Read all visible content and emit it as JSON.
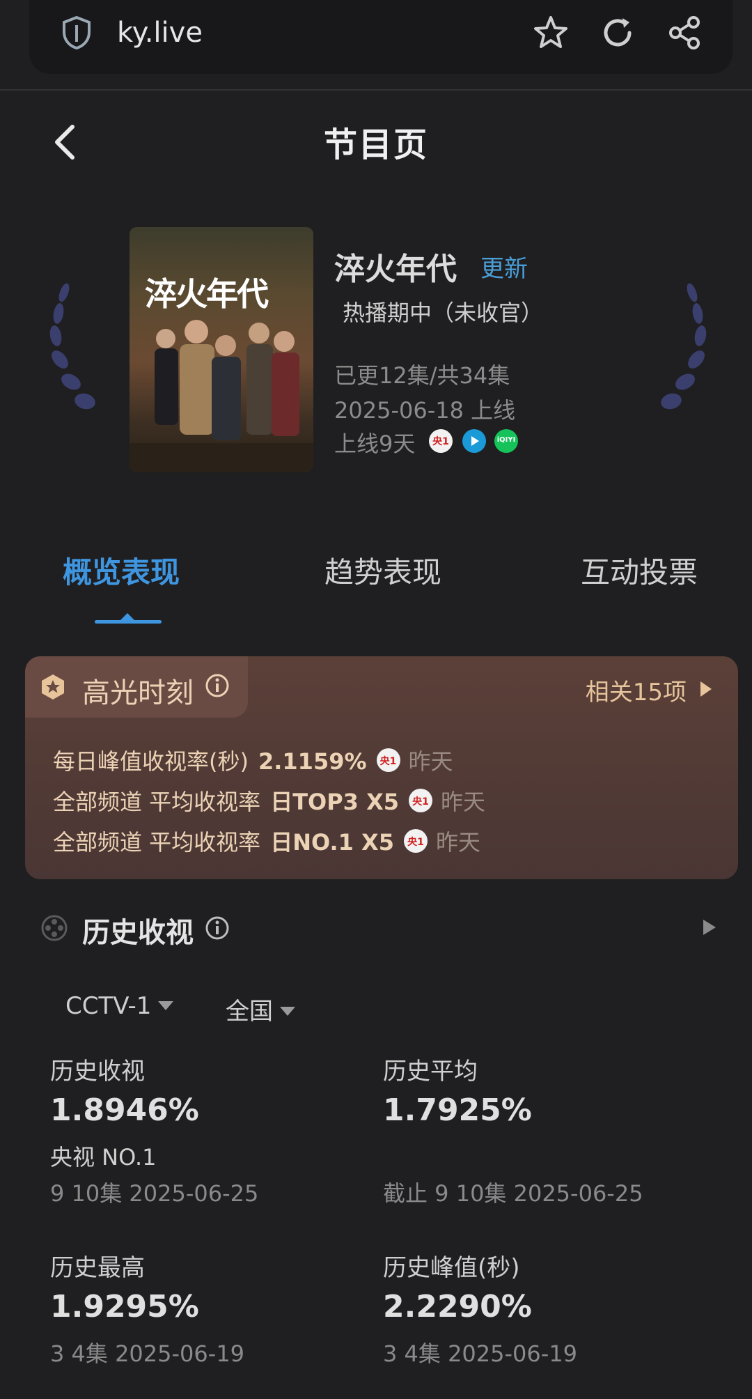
{
  "browser": {
    "url": "ky.live"
  },
  "header": {
    "title": "节目页"
  },
  "show": {
    "poster_title": "淬火年代",
    "title": "淬火年代",
    "update_tag": "更新",
    "status": "热播期中（未收官）",
    "episodes": "已更12集/共34集",
    "premiere": "2025-06-18 上线",
    "days_online": "上线9天",
    "platforms": [
      "央1",
      "腾讯视频",
      "iQIYI"
    ]
  },
  "tabs": [
    "概览表现",
    "趋势表现",
    "互动投票"
  ],
  "highlights": {
    "title": "高光时刻",
    "related": "相关15项",
    "items": [
      {
        "label": "每日峰值收视率(秒)",
        "value": "2.1159%",
        "channel": "央1",
        "when": "昨天"
      },
      {
        "label": "全部频道 平均收视率",
        "value": "日TOP3 X5",
        "channel": "央1",
        "when": "昨天"
      },
      {
        "label": "全部频道 平均收视率",
        "value": "日NO.1 X5",
        "channel": "央1",
        "when": "昨天"
      }
    ]
  },
  "history": {
    "title": "历史收视",
    "filters": {
      "channel": "CCTV-1",
      "region": "全国"
    },
    "stats": [
      {
        "label": "历史收视",
        "value": "1.8946%",
        "sub": "央视 NO.1",
        "detail": "9 10集 2025-06-25"
      },
      {
        "label": "历史平均",
        "value": "1.7925%",
        "sub": "",
        "detail": "截止 9 10集 2025-06-25"
      },
      {
        "label": "历史最高",
        "value": "1.9295%",
        "detail": "3 4集 2025-06-19"
      },
      {
        "label": "历史峰值(秒)",
        "value": "2.2290%",
        "detail": "3 4集 2025-06-19"
      }
    ]
  },
  "colors": {
    "accent": "#3f96e0",
    "highlight_bg": "#4f3936",
    "highlight_text": "#ecd3b6",
    "background": "#1f1f21"
  }
}
